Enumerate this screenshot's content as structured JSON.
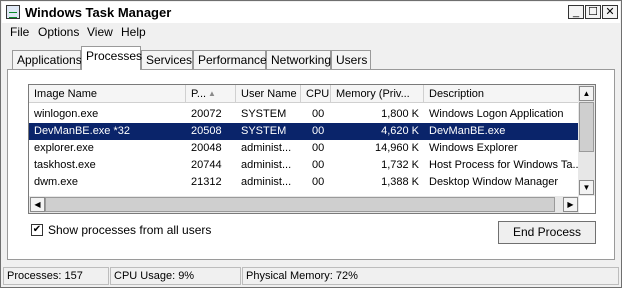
{
  "window": {
    "title": "Windows Task Manager"
  },
  "menu": [
    "File",
    "Options",
    "View",
    "Help"
  ],
  "tabs": [
    "Applications",
    "Processes",
    "Services",
    "Performance",
    "Networking",
    "Users"
  ],
  "active_tab": "Processes",
  "table": {
    "columns": [
      "Image Name",
      "P...",
      "User Name",
      "CPU",
      "Memory (Priv...",
      "Description"
    ],
    "rows": [
      {
        "image": "winlogon.exe",
        "pid": "20072",
        "user": "SYSTEM",
        "cpu": "00",
        "memory": "1,800 K",
        "description": "Windows Logon Application"
      },
      {
        "image": "DevManBE.exe *32",
        "pid": "20508",
        "user": "SYSTEM",
        "cpu": "00",
        "memory": "4,620 K",
        "description": "DevManBE.exe"
      },
      {
        "image": "explorer.exe",
        "pid": "20048",
        "user": "administ...",
        "cpu": "00",
        "memory": "14,960 K",
        "description": "Windows Explorer"
      },
      {
        "image": "taskhost.exe",
        "pid": "20744",
        "user": "administ...",
        "cpu": "00",
        "memory": "1,732 K",
        "description": "Host Process for Windows Ta..."
      },
      {
        "image": "dwm.exe",
        "pid": "21312",
        "user": "administ...",
        "cpu": "00",
        "memory": "1,388 K",
        "description": "Desktop Window Manager"
      }
    ],
    "selected_row_index": 1
  },
  "show_all_users": {
    "label": "Show processes from all users",
    "checked": true
  },
  "end_process_label": "End Process",
  "status": {
    "processes": "Processes: 157",
    "cpu": "CPU Usage: 9%",
    "memory": "Physical Memory: 72%"
  },
  "icons": {
    "app": "task-manager-icon",
    "minimize": "minimize-icon",
    "maximize": "maximize-icon",
    "close": "close-icon",
    "sort": "sort-ascending-icon"
  }
}
